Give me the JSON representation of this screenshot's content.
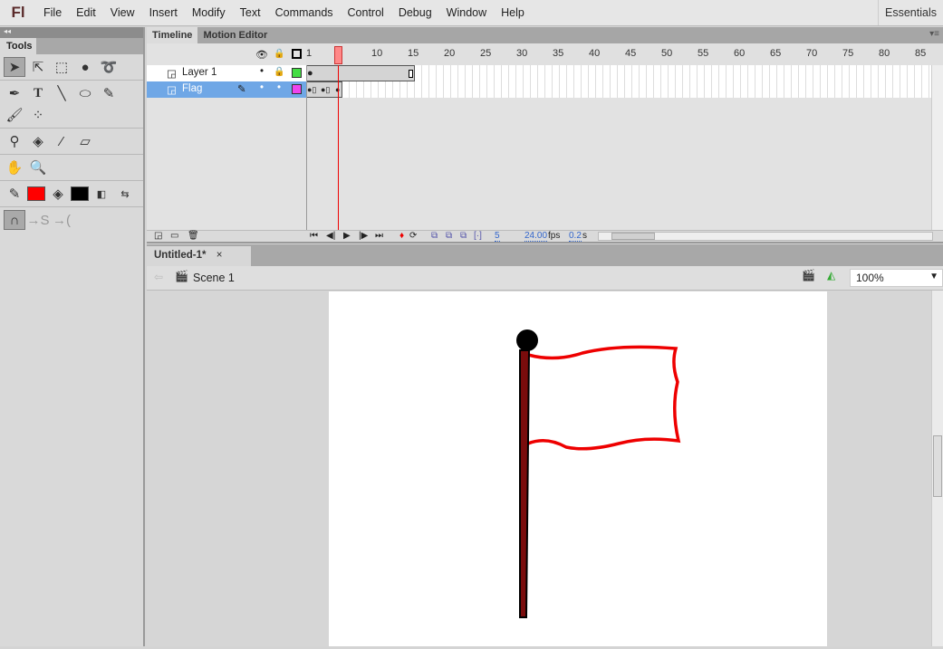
{
  "app": {
    "logo": "Fl",
    "workspace": "Essentials"
  },
  "menu": [
    "File",
    "Edit",
    "View",
    "Insert",
    "Modify",
    "Text",
    "Commands",
    "Control",
    "Debug",
    "Window",
    "Help"
  ],
  "tools": {
    "panel_title": "Tools",
    "stroke_color": "#ff0000",
    "fill_color": "#000000"
  },
  "timeline": {
    "tabs": [
      "Timeline",
      "Motion Editor"
    ],
    "ruler": [
      "1",
      "5",
      "10",
      "15",
      "20",
      "25",
      "30",
      "35",
      "40",
      "45",
      "50",
      "55",
      "60",
      "65",
      "70",
      "75",
      "80",
      "85"
    ],
    "layers": [
      {
        "name": "Layer 1",
        "color": "#44dd44",
        "selected": false
      },
      {
        "name": "Flag",
        "color": "#ee44ee",
        "selected": true
      }
    ],
    "current_frame": "5",
    "fps": "24.00",
    "fps_unit": "fps",
    "elapsed": "0.2",
    "elapsed_unit": "s"
  },
  "document": {
    "tab": "Untitled-1*",
    "close": "×",
    "scene": "Scene 1",
    "zoom": "100%"
  }
}
